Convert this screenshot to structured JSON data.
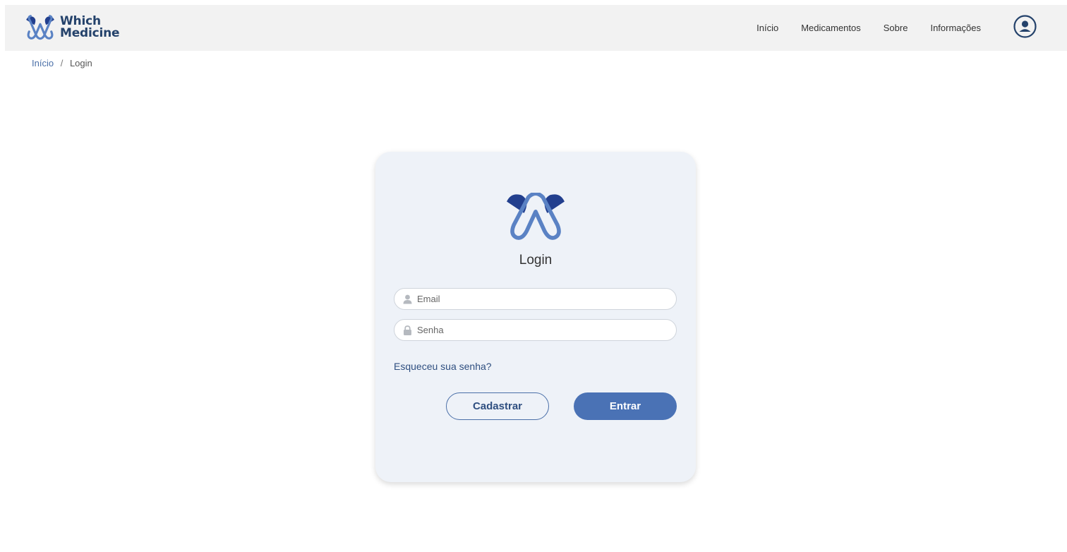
{
  "brand": {
    "line1": "Which",
    "line2": "Medicine"
  },
  "nav": {
    "items": [
      {
        "label": "Início"
      },
      {
        "label": "Medicamentos"
      },
      {
        "label": "Sobre"
      },
      {
        "label": "Informações"
      }
    ],
    "user_icon": "user-circle-icon"
  },
  "breadcrumb": {
    "home": "Início",
    "separator": "/",
    "current": "Login"
  },
  "login": {
    "title": "Login",
    "email": {
      "placeholder": "Email",
      "value": "",
      "icon": "user-icon"
    },
    "password": {
      "placeholder": "Senha",
      "value": "",
      "icon": "lock-icon"
    },
    "forgot_label": "Esqueceu sua senha?",
    "register_label": "Cadastrar",
    "submit_label": "Entrar"
  },
  "colors": {
    "brand_dark": "#24426b",
    "logo_navy": "#223f8e",
    "logo_blue": "#5a82c4",
    "primary": "#4a72b5",
    "link": "#2f4f80",
    "card_bg": "#eef2f8",
    "navbar_bg": "#f2f2f2"
  }
}
